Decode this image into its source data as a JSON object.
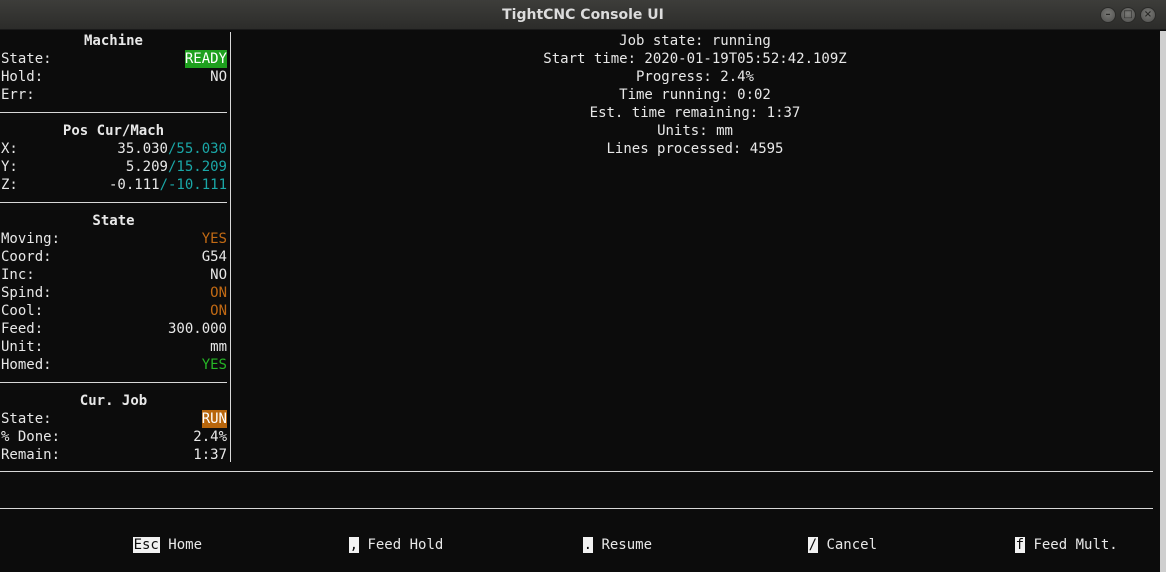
{
  "window": {
    "title": "TightCNC Console UI"
  },
  "sidebar": {
    "machine": {
      "title": "Machine",
      "state_label": "State:",
      "state_value": "READY",
      "hold_label": "Hold:",
      "hold_value": "NO",
      "err_label": "Err:",
      "err_value": ""
    },
    "pos": {
      "title": "Pos Cur/Mach",
      "rows": [
        {
          "label": "X:",
          "cur": "35.030",
          "mach": "/55.030"
        },
        {
          "label": "Y:",
          "cur": "5.209",
          "mach": "/15.209"
        },
        {
          "label": "Z:",
          "cur": "-0.111",
          "mach": "/-10.111"
        }
      ]
    },
    "state": {
      "title": "State",
      "moving_label": "Moving:",
      "moving_value": "YES",
      "coord_label": "Coord:",
      "coord_value": "G54",
      "inc_label": "Inc:",
      "inc_value": "NO",
      "spind_label": "Spind:",
      "spind_value": "ON",
      "cool_label": "Cool:",
      "cool_value": "ON",
      "feed_label": "Feed:",
      "feed_value": "300.000",
      "unit_label": "Unit:",
      "unit_value": "mm",
      "homed_label": "Homed:",
      "homed_value": "YES"
    },
    "job": {
      "title": "Cur. Job",
      "state_label": "State:",
      "state_value": "RUN",
      "done_label": "% Done:",
      "done_value": "2.4%",
      "remain_label": "Remain:",
      "remain_value": "1:37"
    }
  },
  "main": {
    "lines": [
      "Job state: running",
      "Start time: 2020-01-19T05:52:42.109Z",
      "Progress: 2.4%",
      "Time running: 0:02",
      "Est. time remaining: 1:37",
      "Units: mm",
      "Lines processed: 4595"
    ]
  },
  "footer": {
    "keys": [
      {
        "key": "Esc",
        "label": " Home"
      },
      {
        "key": ",",
        "label": " Feed Hold"
      },
      {
        "key": ".",
        "label": " Resume"
      },
      {
        "key": "/",
        "label": " Cancel"
      },
      {
        "key": "f",
        "label": " Feed Mult."
      }
    ]
  },
  "colors": {
    "ready_bg": "#1ea01e",
    "run_bg": "#b8660c",
    "orange_text": "#c26a14",
    "green_text": "#26b526",
    "cyan_text": "#1aa7a7"
  }
}
